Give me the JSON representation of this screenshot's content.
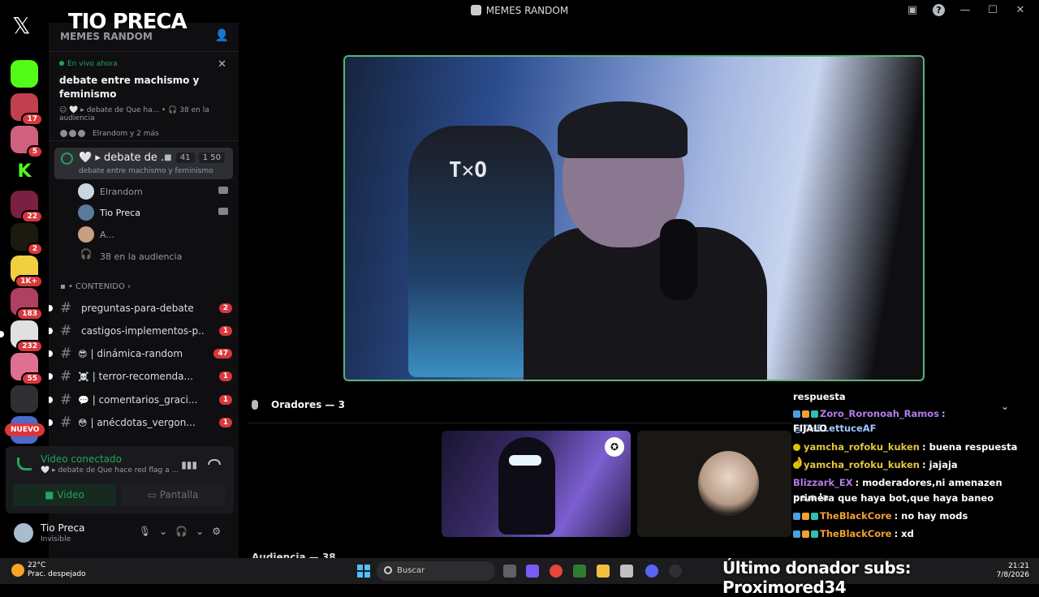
{
  "window": {
    "title": "MEMES RANDOM"
  },
  "overlay": {
    "streamer_name": "TIO PRECA",
    "ticker": "Último donador subs: Proximored34"
  },
  "rail": {
    "badges": [
      "17",
      "5",
      "22",
      "2",
      "1K+",
      "183",
      "232",
      "55"
    ],
    "nuevo": "NUEVO"
  },
  "sidebar": {
    "server_name": "MEMES RANDOM",
    "live": {
      "now": "En vivo ahora",
      "title": "debate entre machismo y feminismo",
      "meta": "☺ 🤍 ▸ debate de Que ha... • 🎧 38 en la audiencia",
      "people": "Elrandom y 2 más"
    },
    "voice_channel": {
      "name": "🤍 ▸ debate de ...",
      "video_count": "41",
      "user_count": "1 50",
      "topic": "debate entre machismo y feminismo"
    },
    "members": [
      {
        "name": "Elrandom"
      },
      {
        "name": "Tio Preca"
      },
      {
        "name": "A..."
      },
      {
        "name": "38 en la audiencia"
      }
    ],
    "category": "CONTENIDO",
    "channels": [
      {
        "emoji": "",
        "label": "preguntas-para-debate",
        "badge": "2"
      },
      {
        "emoji": "",
        "label": "castigos-implementos-p...",
        "badge": "1"
      },
      {
        "emoji": "😎",
        "label": "| dinámica-random",
        "badge": "47"
      },
      {
        "emoji": "☠️",
        "label": "| terror-recomenda...",
        "badge": "1"
      },
      {
        "emoji": "💬",
        "label": "| comentarios_graci...",
        "badge": "1"
      },
      {
        "emoji": "😳",
        "label": "| anécdotas_vergon...",
        "badge": "1"
      }
    ]
  },
  "voice_panel": {
    "status": "Video conectado",
    "channel": "🤍 ▸ debate de Que hace red flag a ...",
    "video_label": "Video",
    "screen_label": "Pantalla"
  },
  "user": {
    "name": "Tio Preca",
    "status": "Invisible"
  },
  "stage": {
    "speakers_label": "Oradores — 3",
    "audience_label": "Audiencia — 38"
  },
  "chat": [
    {
      "user": "",
      "text": "respuesta",
      "color": "#ffffff"
    },
    {
      "user": "Zoro_Roronoah_Ramos",
      "text": ": @THELettuceAF",
      "color": "#b07ce8"
    },
    {
      "user": "",
      "text": "FIJALO",
      "color": "#ffffff"
    },
    {
      "user": "yamcha_rofoku_kuken",
      "text": ": buena respuesta 👌",
      "color": "#e0c542"
    },
    {
      "user": "yamcha_rofoku_kuken",
      "text": ": jajaja",
      "color": "#e0c542"
    },
    {
      "user": "Blizzark_EX",
      "text": ": moderadores,ni amenazen pe,a la",
      "color": "#b07ce8"
    },
    {
      "user": "",
      "text": "primera que haya bot,que haya baneo",
      "color": "#ffffff"
    },
    {
      "user": "TheBlackCore",
      "text": ": no hay mods",
      "color": "#f0a030"
    },
    {
      "user": "TheBlackCore",
      "text": ": xd",
      "color": "#f0a030"
    }
  ],
  "taskbar": {
    "temp": "22°C",
    "weather": "Prac. despejado",
    "search_placeholder": "Buscar",
    "time": "21:21",
    "date": "7/8/2026"
  }
}
